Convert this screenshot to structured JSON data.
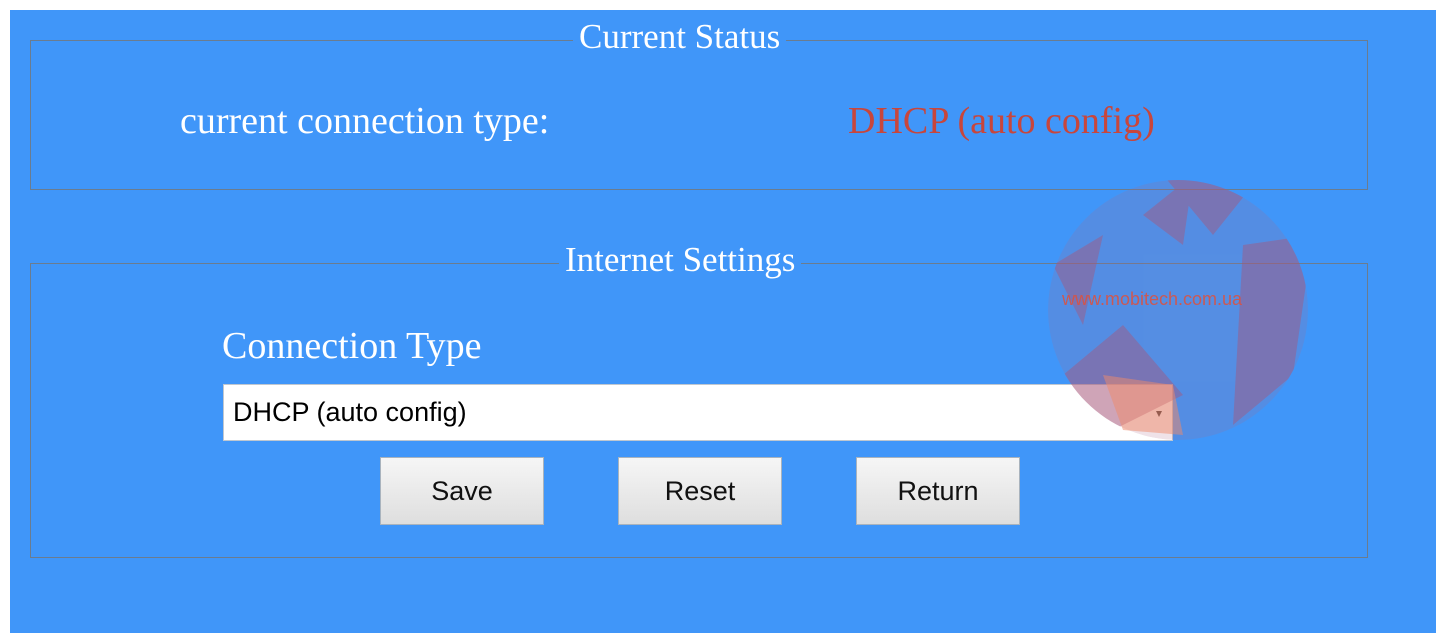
{
  "current_status": {
    "legend": "Current Status",
    "connection_type_label": "current connection type:",
    "connection_type_value": "DHCP (auto config)"
  },
  "internet_settings": {
    "legend": "Internet Settings",
    "connection_type_label": "Connection Type",
    "connection_type_select": {
      "selected": "DHCP (auto config)"
    },
    "buttons": {
      "save": "Save",
      "reset": "Reset",
      "return": "Return"
    }
  },
  "watermark": {
    "text": "www.mobitech.com.ua",
    "icon": "star-globe-watermark"
  },
  "colors": {
    "background": "#4096f9",
    "status_value": "#c8463c",
    "watermark": "#e0503c"
  }
}
